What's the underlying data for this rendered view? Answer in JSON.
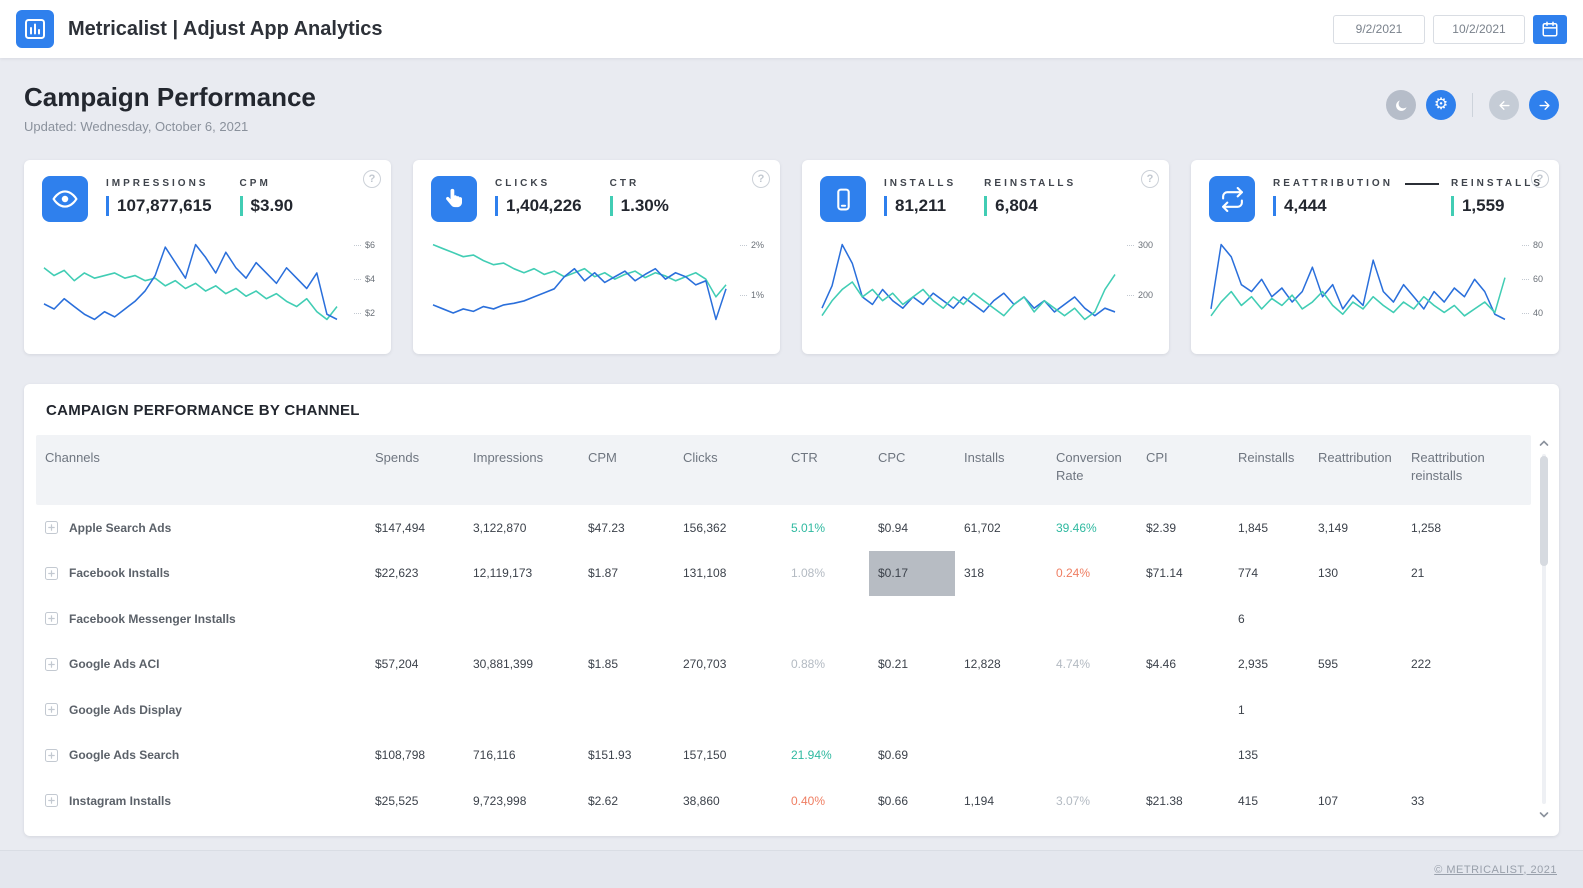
{
  "navbar": {
    "title": "Metricalist | Adjust App Analytics",
    "date_from": "9/2/2021",
    "date_to": "10/2/2021"
  },
  "header": {
    "title": "Campaign Performance",
    "updated": "Updated: Wednesday, October 6, 2021"
  },
  "colors": {
    "accent_blue": "#2f80ed",
    "accent_teal": "#41cdb4",
    "line_blue": "#2a6fdb",
    "line_teal": "#41cdb4",
    "positive_teal": "#2fb9a0",
    "negative_orange": "#ef7e62",
    "muted_gray": "#b3bac2",
    "highlight_cell": "#b7bcc3"
  },
  "kpi_cards": [
    {
      "icon": "eye-icon",
      "metrics": [
        {
          "label": "IMPRESSIONS",
          "value": "107,877,615",
          "accent": "#2f80ed"
        },
        {
          "label": "CPM",
          "value": "$3.90",
          "accent": "#41cdb4"
        }
      ],
      "axis": [
        "$6",
        "$4",
        "$2"
      ],
      "spark": {
        "type": "line",
        "series": [
          {
            "name": "cpm-teal",
            "color": "#41cdb4",
            "values": [
              4.9,
              4.6,
              4.8,
              4.4,
              4.7,
              4.5,
              4.6,
              4.7,
              4.5,
              4.6,
              4.4,
              4.5,
              4.2,
              4.4,
              4.1,
              4.3,
              4.0,
              4.2,
              3.9,
              4.1,
              3.8,
              4.0,
              3.7,
              3.9,
              3.6,
              3.4,
              3.7,
              3.2,
              2.9,
              3.4
            ]
          },
          {
            "name": "cpm-blue",
            "color": "#2a6fdb",
            "values": [
              3.5,
              3.3,
              3.7,
              3.4,
              3.1,
              2.9,
              3.2,
              3.0,
              3.3,
              3.6,
              4.0,
              4.6,
              5.7,
              5.1,
              4.5,
              5.8,
              5.3,
              4.7,
              5.5,
              4.9,
              4.5,
              5.1,
              4.7,
              4.3,
              4.9,
              4.5,
              4.1,
              4.7,
              3.1,
              2.9
            ]
          }
        ]
      }
    },
    {
      "icon": "click-icon",
      "metrics": [
        {
          "label": "CLICKS",
          "value": "1,404,226",
          "accent": "#2f80ed"
        },
        {
          "label": "CTR",
          "value": "1.30%",
          "accent": "#41cdb4"
        }
      ],
      "axis": [
        "2%",
        "1%"
      ],
      "spark": {
        "type": "line",
        "series": [
          {
            "name": "ctr-teal",
            "color": "#41cdb4",
            "values": [
              1.85,
              1.8,
              1.75,
              1.7,
              1.72,
              1.65,
              1.6,
              1.62,
              1.55,
              1.5,
              1.55,
              1.48,
              1.52,
              1.45,
              1.5,
              1.55,
              1.45,
              1.5,
              1.42,
              1.48,
              1.52,
              1.44,
              1.5,
              1.46,
              1.4,
              1.45,
              1.5,
              1.42,
              1.2,
              1.35
            ]
          },
          {
            "name": "ctr-blue",
            "color": "#2a6fdb",
            "values": [
              1.1,
              1.05,
              1.0,
              1.05,
              1.02,
              1.08,
              1.05,
              1.1,
              1.12,
              1.15,
              1.2,
              1.25,
              1.3,
              1.45,
              1.55,
              1.4,
              1.5,
              1.38,
              1.45,
              1.52,
              1.4,
              1.48,
              1.55,
              1.42,
              1.5,
              1.45,
              1.35,
              1.4,
              0.92,
              1.3
            ]
          }
        ]
      }
    },
    {
      "icon": "smartphone-icon",
      "metrics": [
        {
          "label": "INSTALLS",
          "value": "81,211",
          "accent": "#2f80ed"
        },
        {
          "label": "REINSTALLS",
          "value": "6,804",
          "accent": "#41cdb4"
        }
      ],
      "axis": [
        "300",
        "200"
      ],
      "spark": {
        "type": "line",
        "series": [
          {
            "name": "installs-blue",
            "color": "#2a6fdb",
            "values": [
              225,
              255,
              310,
              285,
              240,
              230,
              250,
              235,
              225,
              240,
              230,
              245,
              235,
              225,
              240,
              230,
              220,
              235,
              245,
              230,
              240,
              225,
              235,
              220,
              230,
              240,
              225,
              215,
              225,
              220
            ]
          },
          {
            "name": "reinstalls-teal",
            "color": "#41cdb4",
            "values": [
              215,
              235,
              250,
              260,
              240,
              250,
              235,
              245,
              230,
              240,
              250,
              235,
              225,
              240,
              230,
              245,
              235,
              225,
              215,
              230,
              240,
              220,
              235,
              225,
              215,
              225,
              210,
              220,
              250,
              270
            ]
          }
        ]
      }
    },
    {
      "icon": "repeat-icon",
      "metrics": [
        {
          "label": "REATTRIBUTION",
          "value": "4,444",
          "accent": "#2f80ed"
        },
        {
          "label": "REINSTALLS",
          "value": "1,559",
          "accent": "#41cdb4"
        }
      ],
      "axis": [
        "80",
        "60",
        "40"
      ],
      "spark": {
        "type": "line",
        "series": [
          {
            "name": "reattribution-blue",
            "color": "#2a6fdb",
            "values": [
              48,
              85,
              78,
              62,
              58,
              65,
              55,
              60,
              52,
              58,
              72,
              55,
              62,
              48,
              56,
              50,
              76,
              58,
              52,
              62,
              55,
              48,
              58,
              52,
              60,
              55,
              65,
              58,
              45,
              42
            ]
          },
          {
            "name": "reinstalls-teal",
            "color": "#41cdb4",
            "values": [
              44,
              52,
              58,
              50,
              55,
              48,
              54,
              50,
              56,
              48,
              52,
              58,
              50,
              45,
              52,
              48,
              55,
              50,
              46,
              52,
              48,
              55,
              50,
              46,
              50,
              44,
              48,
              52,
              46,
              66
            ]
          }
        ]
      }
    }
  ],
  "table": {
    "title": "CAMPAIGN PERFORMANCE BY CHANNEL",
    "headers": [
      "Channels",
      "Spends",
      "Impressions",
      "CPM",
      "Clicks",
      "CTR",
      "CPC",
      "Installs",
      "Conversion Rate",
      "CPI",
      "Reinstalls",
      "Reattribution",
      "Reattribution reinstalls"
    ],
    "rows": [
      {
        "cells": [
          "Apple Search Ads",
          "$147,494",
          "3,122,870",
          "$47.23",
          "156,362",
          {
            "text": "5.01%",
            "color": "teal"
          },
          "$0.94",
          "61,702",
          {
            "text": "39.46%",
            "color": "teal"
          },
          "$2.39",
          "1,845",
          "3,149",
          "1,258"
        ]
      },
      {
        "cells": [
          "Facebook Installs",
          "$22,623",
          "12,119,173",
          "$1.87",
          "131,108",
          {
            "text": "1.08%",
            "color": "muted"
          },
          {
            "text": "$0.17",
            "highlight": true
          },
          "318",
          {
            "text": "0.24%",
            "color": "orange"
          },
          "$71.14",
          "774",
          "130",
          "21"
        ]
      },
      {
        "cells": [
          "Facebook Messenger Installs",
          "",
          "",
          "",
          "",
          "",
          "",
          "",
          "",
          "",
          "6",
          "",
          ""
        ]
      },
      {
        "cells": [
          "Google Ads ACI",
          "$57,204",
          "30,881,399",
          "$1.85",
          "270,703",
          {
            "text": "0.88%",
            "color": "muted"
          },
          "$0.21",
          "12,828",
          {
            "text": "4.74%",
            "color": "muted"
          },
          "$4.46",
          "2,935",
          "595",
          "222"
        ]
      },
      {
        "cells": [
          "Google Ads Display",
          "",
          "",
          "",
          "",
          "",
          "",
          "",
          "",
          "",
          "1",
          "",
          ""
        ]
      },
      {
        "cells": [
          "Google Ads Search",
          "$108,798",
          "716,116",
          "$151.93",
          "157,150",
          {
            "text": "21.94%",
            "color": "teal"
          },
          "$0.69",
          "",
          "",
          "",
          "135",
          "",
          ""
        ]
      },
      {
        "cells": [
          "Instagram Installs",
          "$25,525",
          "9,723,998",
          "$2.62",
          "38,860",
          {
            "text": "0.40%",
            "color": "orange"
          },
          "$0.66",
          "1,194",
          {
            "text": "3.07%",
            "color": "muted"
          },
          "$21.38",
          "415",
          "107",
          "33"
        ]
      }
    ]
  },
  "footer": {
    "copyright": "© METRICALIST, 2021"
  }
}
